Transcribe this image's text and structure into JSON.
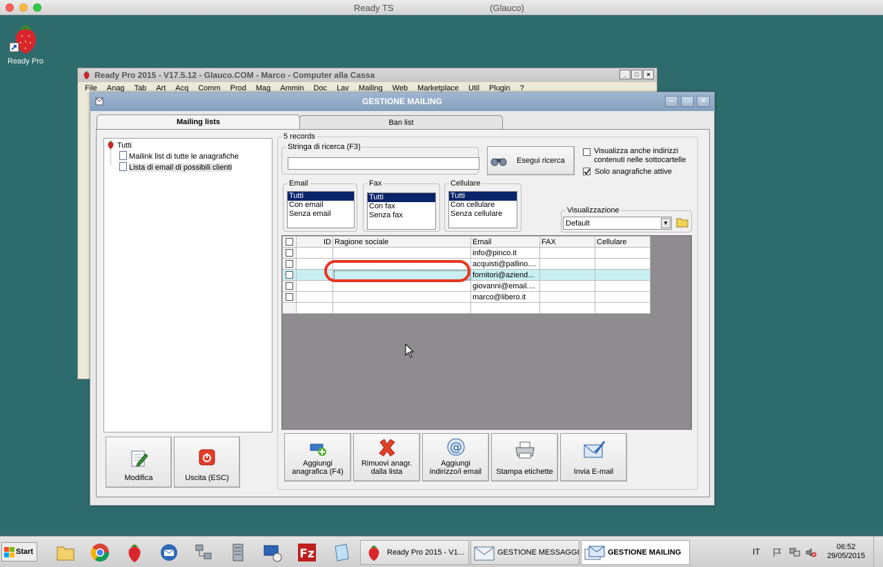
{
  "mac": {
    "title": "Ready TS",
    "subtitle": "(Glauco)"
  },
  "desktop": {
    "icon_label": "Ready Pro"
  },
  "back_window": {
    "title": "Ready Pro 2015 - V17.5.12 - Glauco.COM - Marco - Computer alla Cassa",
    "menu": [
      "File",
      "Anag",
      "Tab",
      "Art",
      "Acq",
      "Comm",
      "Prod",
      "Mag",
      "Ammin",
      "Doc",
      "Lav",
      "Mailing",
      "Web",
      "Marketplace",
      "Util",
      "Plugin",
      "?"
    ]
  },
  "dialog": {
    "title": "GESTIONE MAILING",
    "tabs": {
      "mailing": "Mailing lists",
      "ban": "Ban list"
    },
    "tree": {
      "root": "Tutti",
      "items": [
        "Mailink list di tutte le anagrafiche",
        "Lista di email di possibili clienti"
      ]
    },
    "records": "5 records",
    "search": {
      "label": "Stringa di ricerca (F3)",
      "value": "",
      "button": "Esegui ricerca"
    },
    "options": {
      "subfolders": "Visualizza anche indirizzi contenuti nelle sottocartelle",
      "subfolders_checked": false,
      "active_only": "Solo anagrafiche attive",
      "active_only_checked": true
    },
    "filters": {
      "email": {
        "label": "Email",
        "items": [
          "Tutti",
          "Con email",
          "Senza email"
        ]
      },
      "fax": {
        "label": "Fax",
        "items": [
          "Tutti",
          "Con fax",
          "Senza fax"
        ]
      },
      "cell": {
        "label": "Cellulare",
        "items": [
          "Tutti",
          "Con cellulare",
          "Senza cellulare"
        ]
      }
    },
    "view": {
      "label": "Visualizzazione",
      "value": "Default"
    },
    "grid": {
      "columns": [
        "ID",
        "Ragione sociale",
        "Email",
        "FAX",
        "Cellulare"
      ],
      "rows": [
        {
          "id": "",
          "name": "",
          "email": "info@pinco.it",
          "fax": "",
          "cell": ""
        },
        {
          "id": "",
          "name": "",
          "email": "acquisti@pallino....",
          "fax": "",
          "cell": ""
        },
        {
          "id": "",
          "name": "",
          "email": "fornitori@aziend...",
          "fax": "",
          "cell": ""
        },
        {
          "id": "",
          "name": "",
          "email": "giovanni@email....",
          "fax": "",
          "cell": ""
        },
        {
          "id": "",
          "name": "",
          "email": "marco@libero.it",
          "fax": "",
          "cell": ""
        }
      ]
    },
    "buttons": {
      "modifica": "Modifica",
      "uscita": "Uscita (ESC)",
      "aggiungi": "Aggiungi anagrafica (F4)",
      "rimuovi": "Rimuovi anagr. dalla lista",
      "aggiungi_email": "Aggiungi indirizzo/i email",
      "stampa": "Stampa etichette",
      "invia": "Invia E-mail"
    }
  },
  "taskbar": {
    "start": "Start",
    "tasks": [
      "Ready Pro 2015 - V1...",
      "GESTIONE MESSAGGI...",
      "GESTIONE MAILING"
    ],
    "lang": "IT",
    "time": "06:52",
    "date": "29/05/2015"
  }
}
